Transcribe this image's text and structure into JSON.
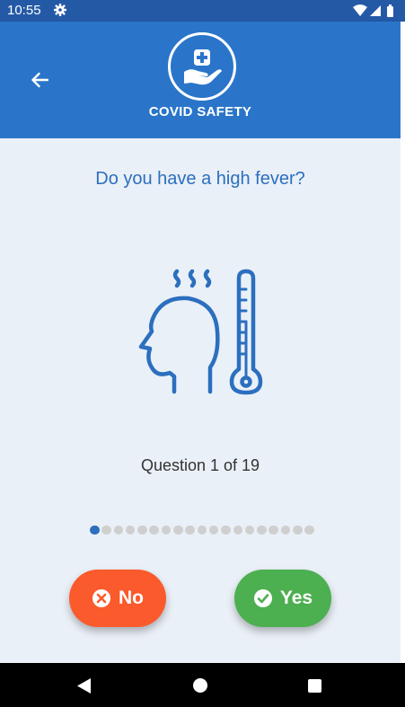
{
  "status_bar": {
    "time": "10:55"
  },
  "app_bar": {
    "title": "COVID SAFETY"
  },
  "question": {
    "text": "Do you have a high fever?"
  },
  "progress": {
    "text": "Question 1 of 19",
    "current": 1,
    "total": 19
  },
  "buttons": {
    "no_label": "No",
    "yes_label": "Yes"
  },
  "colors": {
    "status_bar": "#2459a6",
    "app_bar": "#2a75c9",
    "content_background": "#eaf0f7",
    "accent_blue": "#2b6fbf",
    "no_button": "#fa5a2c",
    "yes_button": "#4caf50",
    "dot_inactive": "#cfcfcf"
  },
  "icons": {
    "status_left": "gear-icon",
    "status_right": [
      "wifi-icon",
      "cell-signal-icon",
      "battery-icon"
    ],
    "app_bar": [
      "back-arrow-icon",
      "hand-medical-cross-logo"
    ],
    "illustration": "head-thermometer-fever-icon",
    "buttons": [
      "close-circle-icon",
      "check-circle-icon"
    ],
    "nav": [
      "nav-back-icon",
      "nav-home-icon",
      "nav-recents-icon"
    ]
  }
}
